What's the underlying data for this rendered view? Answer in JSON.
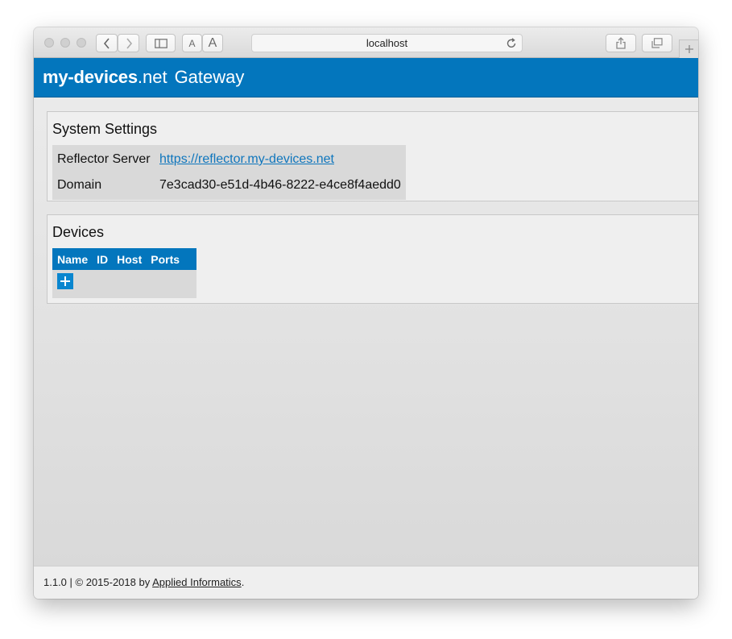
{
  "browser": {
    "address": "localhost"
  },
  "header": {
    "brand_bold": "my-devices",
    "brand_light": ".net",
    "brand_suffix": "Gateway"
  },
  "system_settings": {
    "title": "System Settings",
    "rows": [
      {
        "key": "Reflector Server",
        "value": "https://reflector.my-devices.net"
      },
      {
        "key": "Domain",
        "value": "7e3cad30-e51d-4b46-8222-e4ce8f4aedd0"
      }
    ]
  },
  "devices": {
    "title": "Devices",
    "columns": [
      "Name",
      "ID",
      "Host",
      "Ports"
    ]
  },
  "footer": {
    "prefix": "1.1.0 | © 2015-2018 by ",
    "link": "Applied Informatics",
    "suffix": "."
  },
  "colors": {
    "brand_blue": "#0376bd",
    "link_blue": "#0f76bd"
  }
}
